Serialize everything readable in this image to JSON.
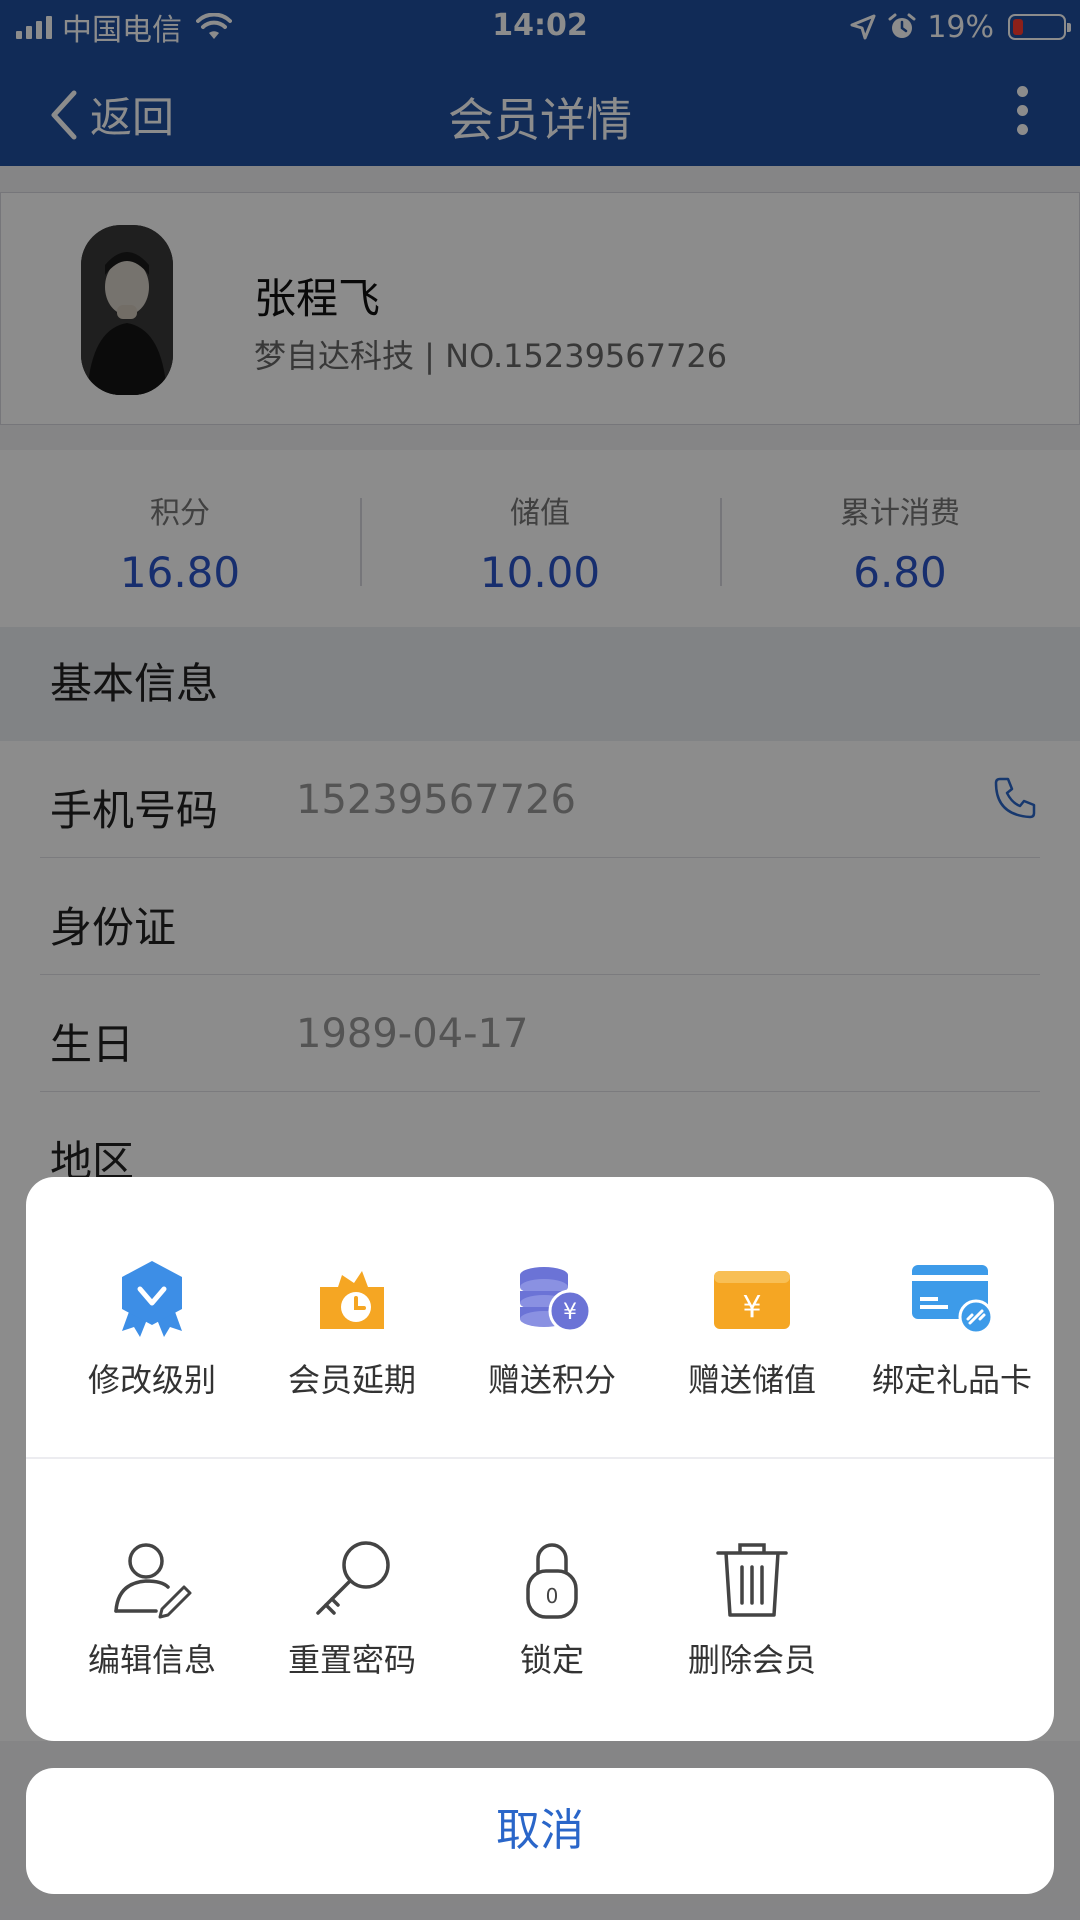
{
  "status_bar": {
    "carrier": "中国电信",
    "time": "14:02",
    "battery_percent": "19%",
    "battery_level": 0.19,
    "icons": [
      "signal-icon",
      "wifi-icon",
      "location-icon",
      "alarm-icon",
      "battery-icon"
    ]
  },
  "nav": {
    "back_label": "返回",
    "title": "会员详情"
  },
  "profile": {
    "name": "张程飞",
    "subtitle": "梦自达科技 | NO.15239567726"
  },
  "stats": [
    {
      "label": "积分",
      "value": "16.80"
    },
    {
      "label": "储值",
      "value": "10.00"
    },
    {
      "label": "累计消费",
      "value": "6.80"
    }
  ],
  "basic_info": {
    "header": "基本信息",
    "rows": [
      {
        "label": "手机号码",
        "value": "15239567726"
      },
      {
        "label": "身份证",
        "value": ""
      },
      {
        "label": "生日",
        "value": "1989-04-17"
      },
      {
        "label": "地区",
        "value": ""
      }
    ]
  },
  "action_sheet": {
    "row1": [
      {
        "label": "修改级别",
        "icon": "level-badge-icon",
        "color": "#3d8ee6"
      },
      {
        "label": "会员延期",
        "icon": "clock-extend-icon",
        "color": "#f5a623"
      },
      {
        "label": "赠送积分",
        "icon": "coins-yuan-icon",
        "color": "#6b73d6"
      },
      {
        "label": "赠送储值",
        "icon": "wallet-yuan-icon",
        "color": "#f5a623"
      },
      {
        "label": "绑定礼品卡",
        "icon": "gift-card-link-icon",
        "color": "#3d9be9"
      }
    ],
    "row2": [
      {
        "label": "编辑信息",
        "icon": "edit-user-icon"
      },
      {
        "label": "重置密码",
        "icon": "key-icon"
      },
      {
        "label": "锁定",
        "icon": "lock-icon"
      },
      {
        "label": "删除会员",
        "icon": "trash-icon"
      }
    ],
    "cancel_label": "取消"
  },
  "colors": {
    "nav_bg": "#1f4f9f",
    "stat_value": "#2a55c9",
    "cancel_text": "#2a66c9"
  }
}
